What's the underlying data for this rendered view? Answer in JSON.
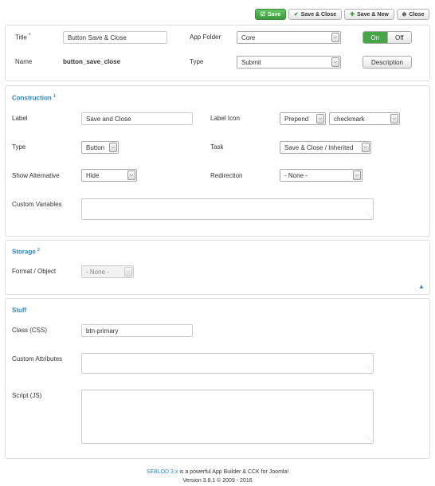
{
  "toolbar": {
    "save": "Save",
    "save_close": "Save & Close",
    "save_new": "Save & New",
    "close": "Close"
  },
  "header": {
    "title_label": "Title",
    "required_mark": "*",
    "title_value": "Button Save & Close",
    "name_label": "Name",
    "name_value": "button_save_close",
    "app_folder_label": "App Folder",
    "app_folder_value": "Core",
    "type_label": "Type",
    "type_value": "Submit",
    "toggle_on": "On",
    "toggle_off": "Off",
    "toggle_state": "On",
    "description_button": "Description"
  },
  "construction": {
    "title": "Construction",
    "title_sup": "1",
    "label_label": "Label",
    "label_value": "Save and Close",
    "label_icon_label": "Label Icon",
    "label_icon_position": "Prepend",
    "label_icon_value": "checkmark",
    "type_label": "Type",
    "type_value": "Button",
    "task_label": "Task",
    "task_value": "Save & Close / Inherited",
    "show_alt_label": "Show Alternative",
    "show_alt_value": "Hide",
    "redirection_label": "Redirection",
    "redirection_value": "- None -",
    "custom_vars_label": "Custom Variables",
    "custom_vars_value": ""
  },
  "storage": {
    "title": "Storage",
    "title_sup": "2",
    "format_label": "Format / Object",
    "format_value": "- None -"
  },
  "stuff": {
    "title": "Stuff",
    "class_label": "Class (CSS)",
    "class_value": "btn-primary",
    "custom_attr_label": "Custom Attributes",
    "custom_attr_value": "",
    "script_label": "Script (JS)",
    "script_value": ""
  },
  "footer": {
    "brand": "SEBLOD 3.x",
    "tagline": " is a powerful App Builder & CCK for Joomla!",
    "version": "Version 3.8.1 © 2009 - 2016"
  },
  "colors": {
    "accent": "#2a87c8",
    "primary_green": "#46a546"
  },
  "icons": {
    "save": "save-icon",
    "save_close": "check-icon",
    "save_new": "plus-icon",
    "close": "close-circle-icon",
    "collapse": "chevron-up-icon"
  }
}
